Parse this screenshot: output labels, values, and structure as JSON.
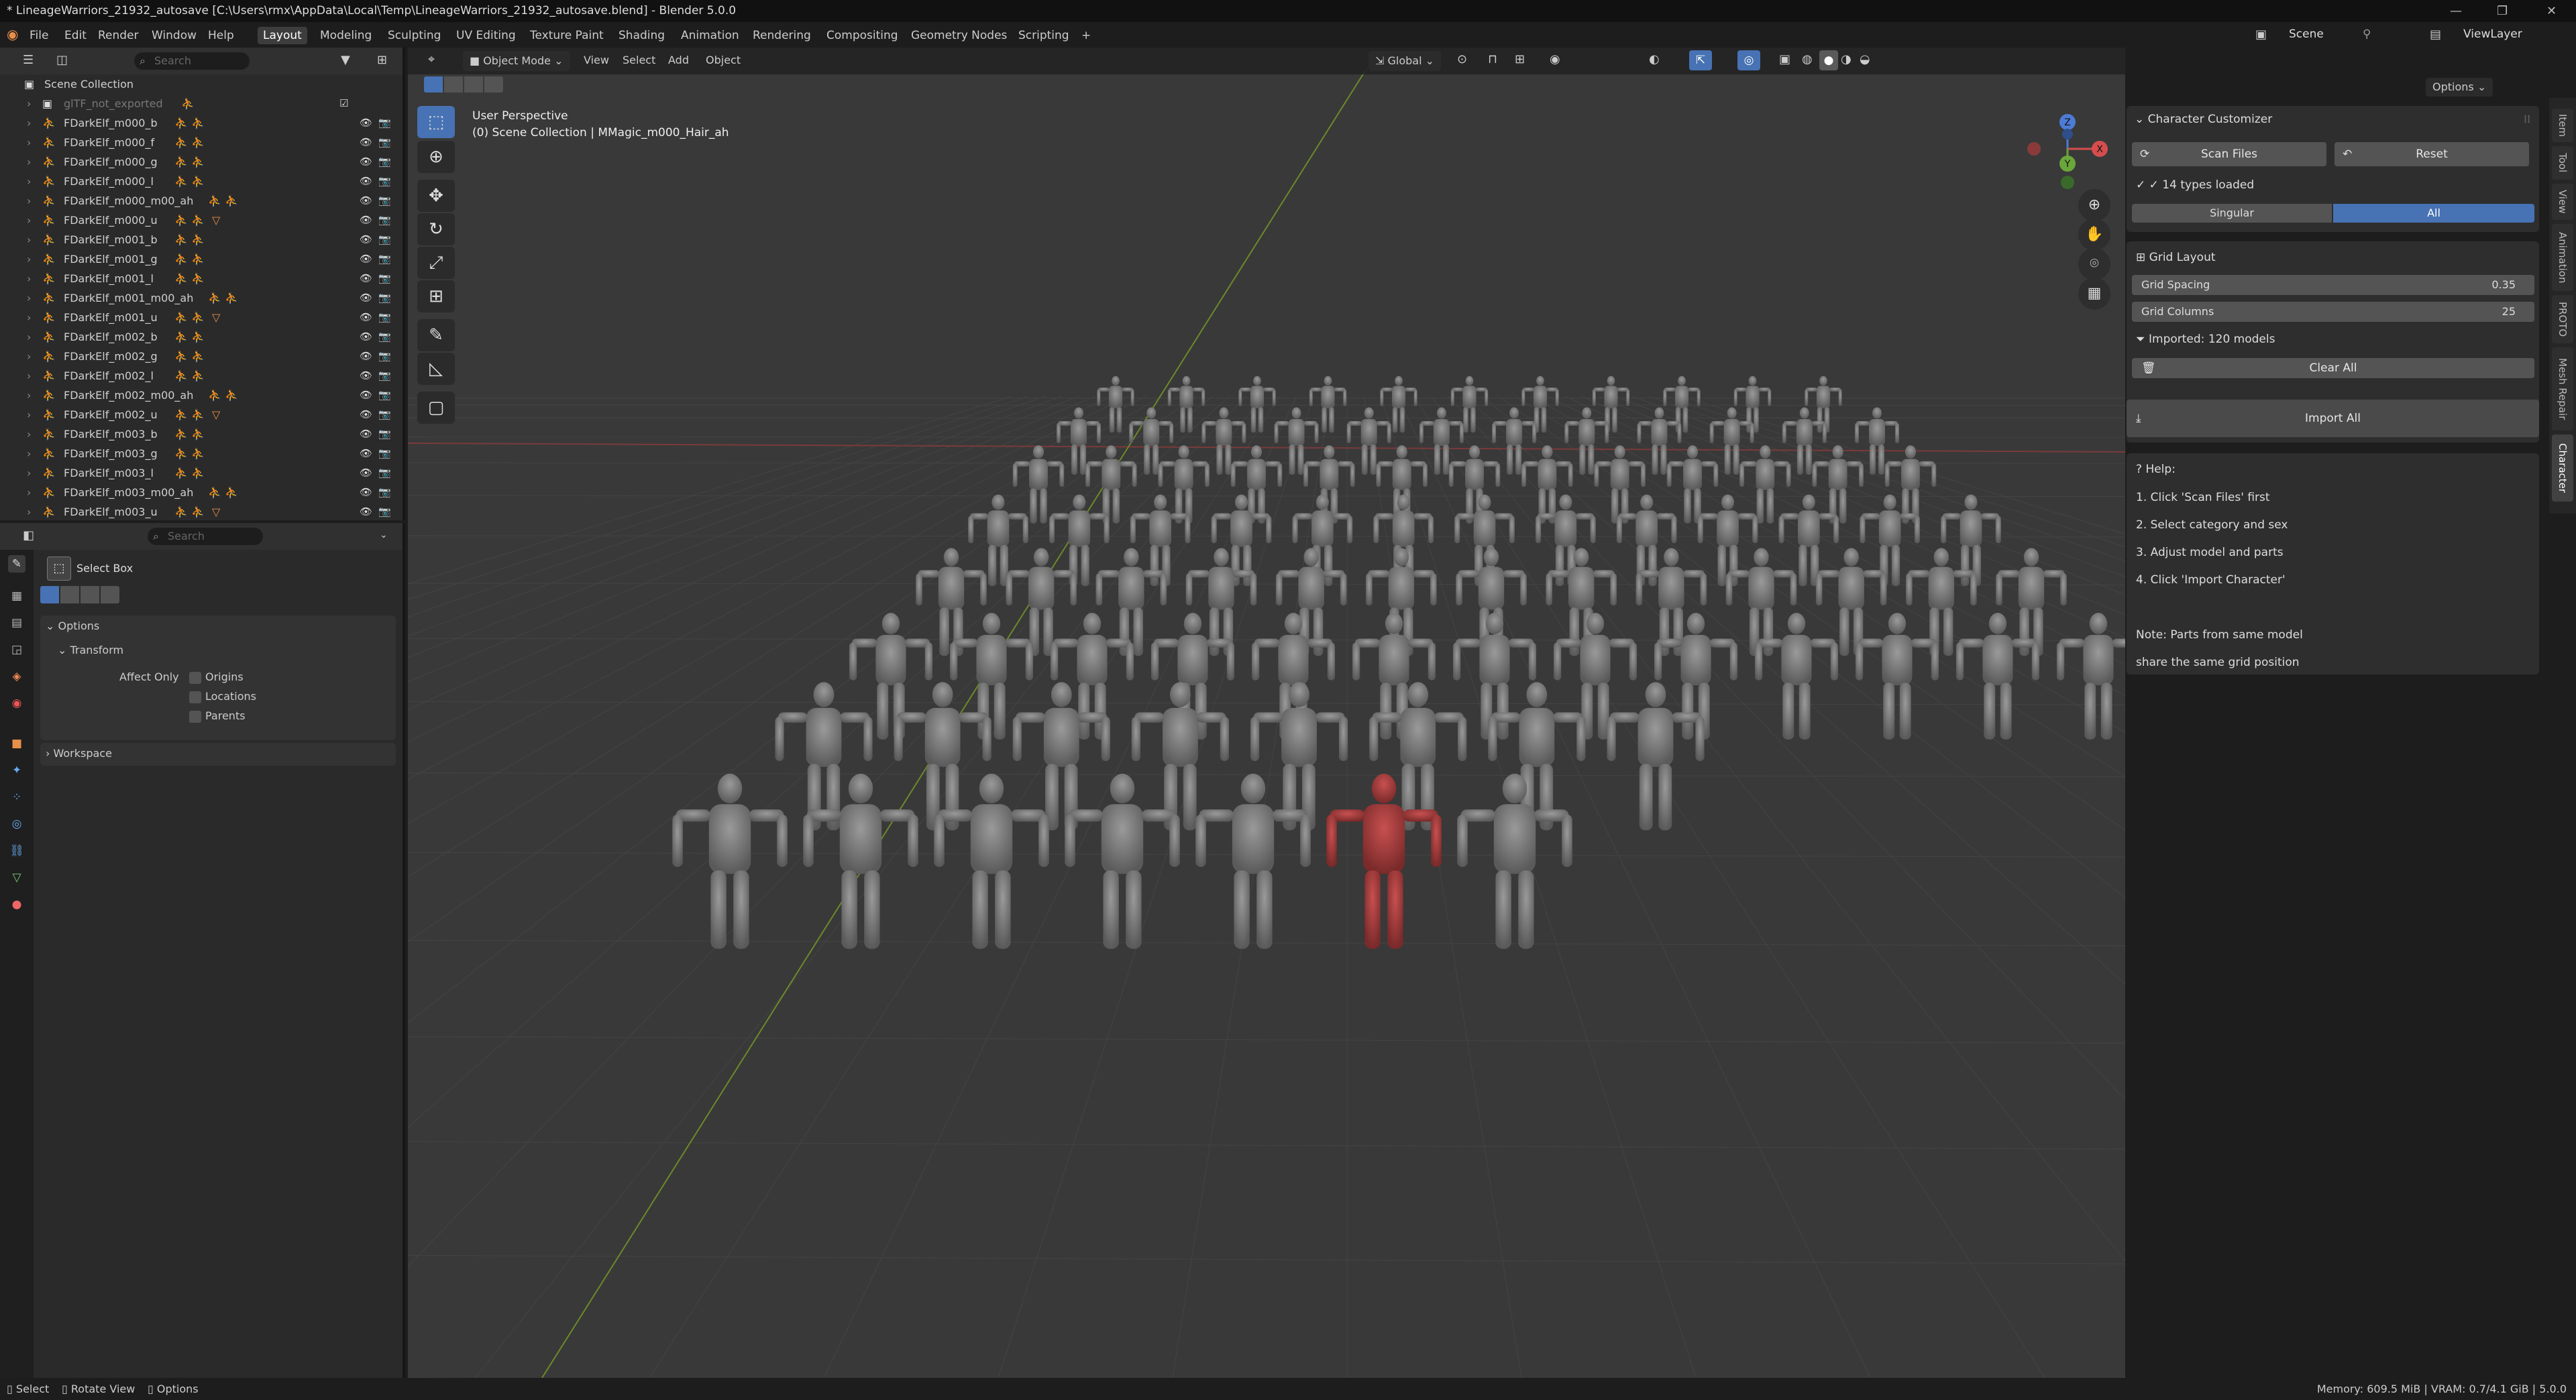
{
  "window": {
    "title": "* LineageWarriors_21932_autosave [C:\\Users\\rmx\\AppData\\Local\\Temp\\LineageWarriors_21932_autosave.blend] - Blender 5.0.0"
  },
  "menu": {
    "items": [
      "File",
      "Edit",
      "Render",
      "Window",
      "Help"
    ]
  },
  "workspaces": {
    "tabs": [
      "Layout",
      "Modeling",
      "Sculpting",
      "UV Editing",
      "Texture Paint",
      "Shading",
      "Animation",
      "Rendering",
      "Compositing",
      "Geometry Nodes",
      "Scripting"
    ],
    "active": "Layout"
  },
  "scene": {
    "label": "Scene"
  },
  "viewlayer": {
    "label": "ViewLayer"
  },
  "outliner": {
    "search_placeholder": "Search",
    "collection_label": "Scene Collection",
    "rows": [
      {
        "name": "glTF_not_exported",
        "dim": true
      },
      {
        "name": "FDarkElf_m000_b"
      },
      {
        "name": "FDarkElf_m000_f"
      },
      {
        "name": "FDarkElf_m000_g"
      },
      {
        "name": "FDarkElf_m000_l"
      },
      {
        "name": "FDarkElf_m000_m00_ah"
      },
      {
        "name": "FDarkElf_m000_u"
      },
      {
        "name": "FDarkElf_m001_b"
      },
      {
        "name": "FDarkElf_m001_g"
      },
      {
        "name": "FDarkElf_m001_l"
      },
      {
        "name": "FDarkElf_m001_m00_ah"
      },
      {
        "name": "FDarkElf_m001_u"
      },
      {
        "name": "FDarkElf_m002_b"
      },
      {
        "name": "FDarkElf_m002_g"
      },
      {
        "name": "FDarkElf_m002_l"
      },
      {
        "name": "FDarkElf_m002_m00_ah"
      },
      {
        "name": "FDarkElf_m002_u"
      },
      {
        "name": "FDarkElf_m003_b"
      },
      {
        "name": "FDarkElf_m003_g"
      },
      {
        "name": "FDarkElf_m003_l"
      },
      {
        "name": "FDarkElf_m003_m00_ah"
      },
      {
        "name": "FDarkElf_m003_u"
      }
    ]
  },
  "properties": {
    "search_placeholder": "Search",
    "tool_name": "Select Box",
    "options_label": "Options",
    "transform_label": "Transform",
    "affect_only_label": "Affect Only",
    "checkboxes": [
      "Origins",
      "Locations",
      "Parents"
    ],
    "workspace_label": "Workspace"
  },
  "viewport": {
    "mode": "Object Mode",
    "menus": [
      "View",
      "Select",
      "Add",
      "Object"
    ],
    "orientation": "Global",
    "options_label": "Options",
    "perspective_label": "User Perspective",
    "context_label": "(0) Scene Collection | MMagic_m000_Hair_ah"
  },
  "npanel": {
    "title": "Character Customizer",
    "scan_label": "Scan Files",
    "reset_label": "Reset",
    "types_loaded": "✓ 14 types loaded",
    "toggle_singular": "Singular",
    "toggle_all": "All",
    "grid_layout_label": "Grid Layout",
    "grid_spacing_label": "Grid Spacing",
    "grid_spacing_value": "0.35",
    "grid_columns_label": "Grid Columns",
    "grid_columns_value": "25",
    "imported_label": "Imported: 120 models",
    "clear_all_label": "Clear All",
    "import_all_label": "Import All",
    "help_title": "Help:",
    "help_lines": [
      "1. Click 'Scan Files' first",
      "2. Select category and sex",
      "3. Adjust model and parts",
      "4. Click 'Import Character'"
    ],
    "note_lines": [
      "Note: Parts from same model",
      "share the same grid position"
    ],
    "tabs": [
      "Item",
      "Tool",
      "View",
      "Animation",
      "PROTO",
      "Mesh Repair",
      "Character"
    ],
    "active_tab": "Character"
  },
  "status": {
    "select": "Select",
    "rotate": "Rotate View",
    "options": "Options",
    "memory": "Memory: 609.5 MiB | VRAM: 0.7/4.1 GiB | 5.0.0"
  },
  "colors": {
    "accent": "#4772b3",
    "object_icon": "#e8904a",
    "modifier_icon": "#7fcf9a",
    "highlight_mesh": "#a83a3a"
  }
}
